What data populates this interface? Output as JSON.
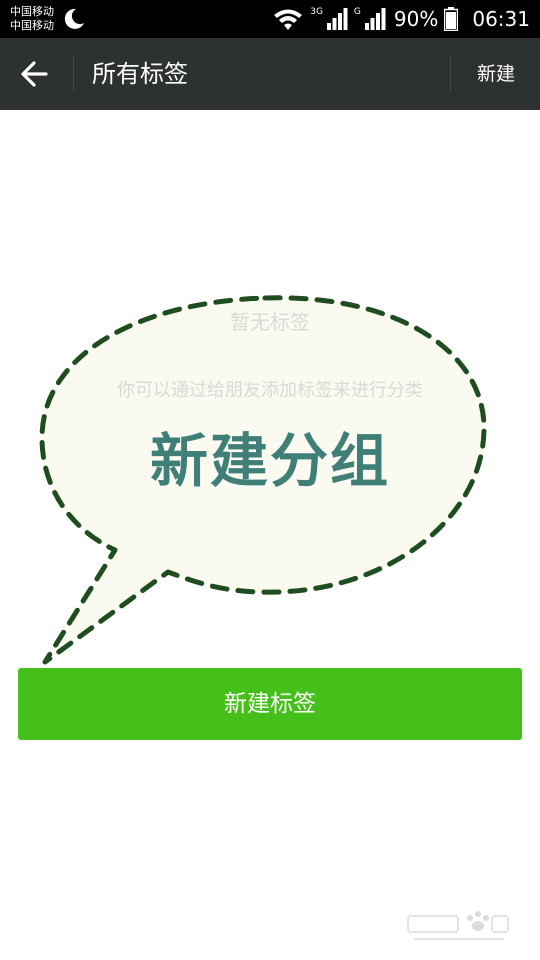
{
  "status_bar": {
    "carrier_1": "中国移动",
    "carrier_2": "中国移动",
    "network_1": "3G",
    "network_2": "G",
    "battery": "90%",
    "time": "06:31"
  },
  "header": {
    "title": "所有标签",
    "new_label": "新建"
  },
  "empty_state": {
    "title": "暂无标签",
    "hint": "你可以通过给朋友添加标签来进行分类",
    "annotation": "新建分组"
  },
  "primary_button": {
    "label": "新建标签"
  },
  "colors": {
    "header_bg": "#2e3132",
    "button_green": "#45c01a",
    "annotation_text": "#3f7f77",
    "bubble_fill": "#fafaf0",
    "bubble_outline": "#1f4d1f"
  },
  "icons": {
    "back": "arrow-left-icon",
    "moon": "moon-icon",
    "wifi": "wifi-icon",
    "signal": "signal-icon",
    "battery": "battery-icon"
  }
}
